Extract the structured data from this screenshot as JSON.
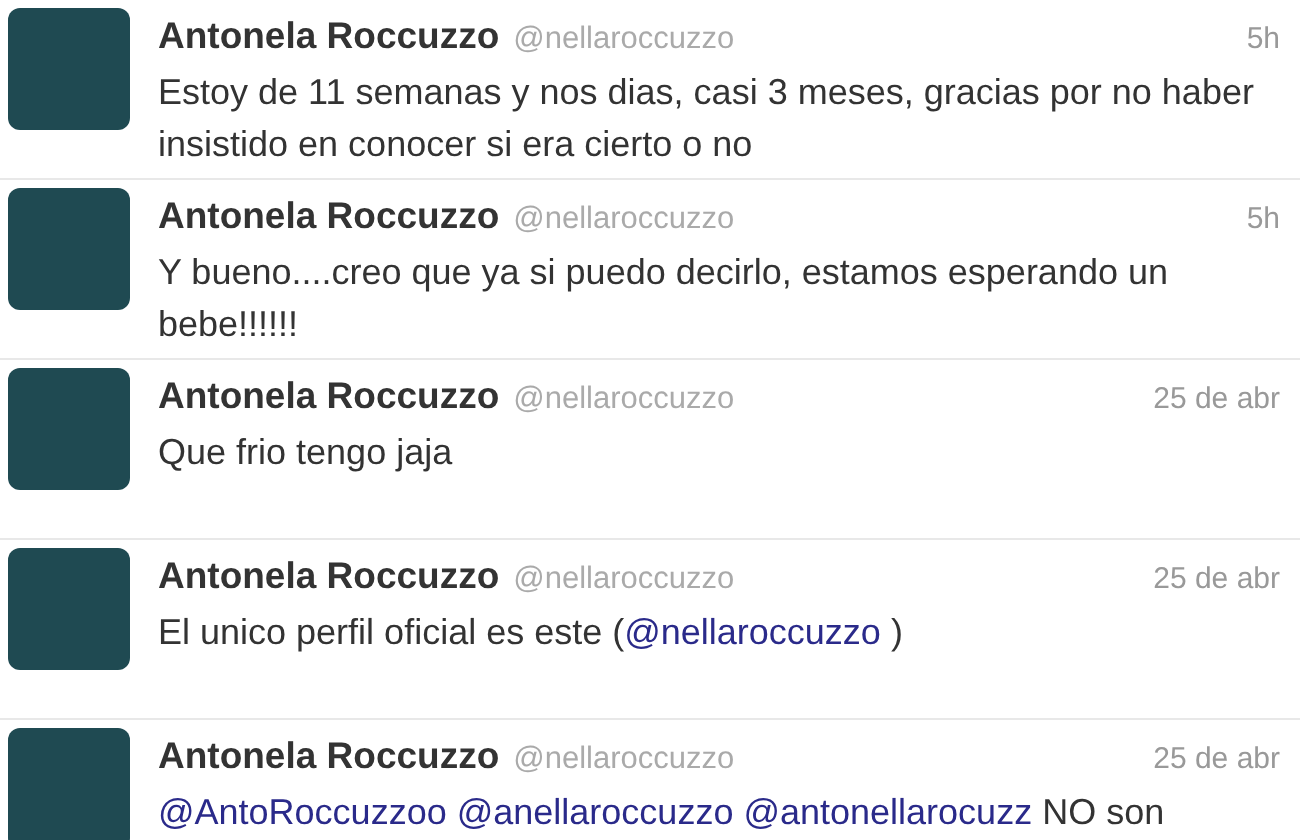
{
  "tweets": [
    {
      "name": "Antonela Roccuzzo",
      "handle": "@nellaroccuzzo",
      "time": "5h",
      "text": [
        {
          "kind": "text",
          "value": "Estoy de 11 semanas y nos dias, casi 3 meses, gracias por no haber insistido en conocer si era cierto o no"
        }
      ]
    },
    {
      "name": "Antonela Roccuzzo",
      "handle": "@nellaroccuzzo",
      "time": "5h",
      "text": [
        {
          "kind": "text",
          "value": "Y bueno....creo que ya si puedo decirlo, estamos esperando un bebe!!!!!!"
        }
      ]
    },
    {
      "name": "Antonela Roccuzzo",
      "handle": "@nellaroccuzzo",
      "time": "25 de abr",
      "text": [
        {
          "kind": "text",
          "value": "Que frio tengo jaja"
        }
      ]
    },
    {
      "name": "Antonela Roccuzzo",
      "handle": "@nellaroccuzzo",
      "time": "25 de abr",
      "text": [
        {
          "kind": "text",
          "value": "El unico perfil oficial es este ("
        },
        {
          "kind": "mention",
          "value": "@nellaroccuzzo"
        },
        {
          "kind": "text",
          "value": " )"
        }
      ]
    },
    {
      "name": "Antonela Roccuzzo",
      "handle": "@nellaroccuzzo",
      "time": "25 de abr",
      "text": [
        {
          "kind": "mention",
          "value": "@AntoRoccuzzoo"
        },
        {
          "kind": "mention",
          "value": "@anellaroccuzzo"
        },
        {
          "kind": "mention",
          "value": "@antonellarocuzz"
        },
        {
          "kind": "text",
          "value": " NO son"
        }
      ]
    }
  ]
}
